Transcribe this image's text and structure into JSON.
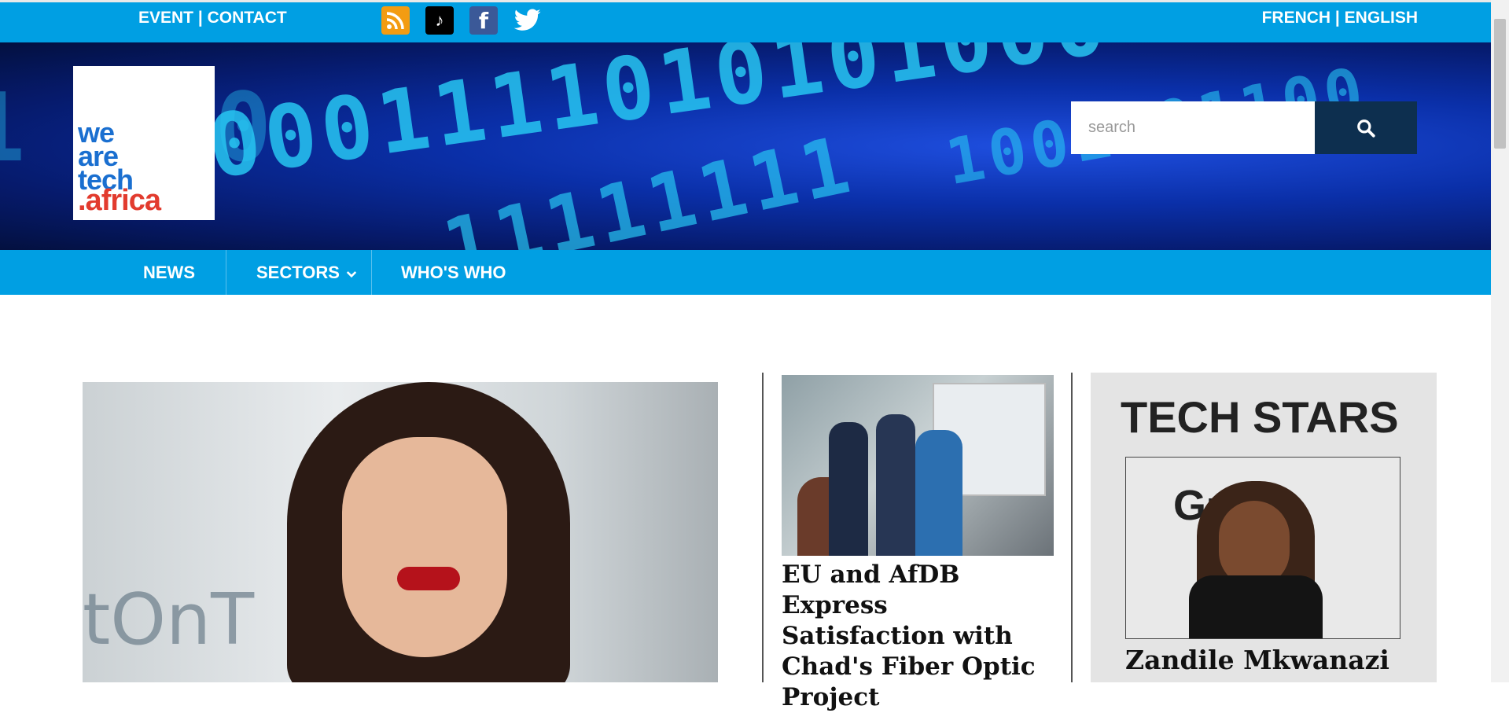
{
  "top_bar": {
    "event_label": "EVENT",
    "separator": "|",
    "contact_label": "CONTACT",
    "french_label": "FRENCH",
    "english_label": "ENGLISH",
    "social_icons": [
      "rss-icon",
      "tiktok-icon",
      "facebook-icon",
      "twitter-icon"
    ]
  },
  "header": {
    "logo_text_lines": [
      "we",
      "are",
      "tech",
      ".africa"
    ],
    "search": {
      "placeholder": "search"
    }
  },
  "nav": {
    "items": [
      {
        "label": "NEWS"
      },
      {
        "label": "SECTORS",
        "has_dropdown": true
      },
      {
        "label": "WHO'S WHO"
      }
    ]
  },
  "main": {
    "news_article": {
      "title": "EU and AfDB Express Satisfaction with Chad's Fiber Optic Project"
    },
    "tech_stars": {
      "heading": "TECH STARS",
      "featured_name": "Zandile Mkwanazi"
    }
  },
  "colors": {
    "primary_blue": "#009fe3",
    "search_button": "#0d2f4f",
    "panel_bg": "#e4e4e4"
  }
}
